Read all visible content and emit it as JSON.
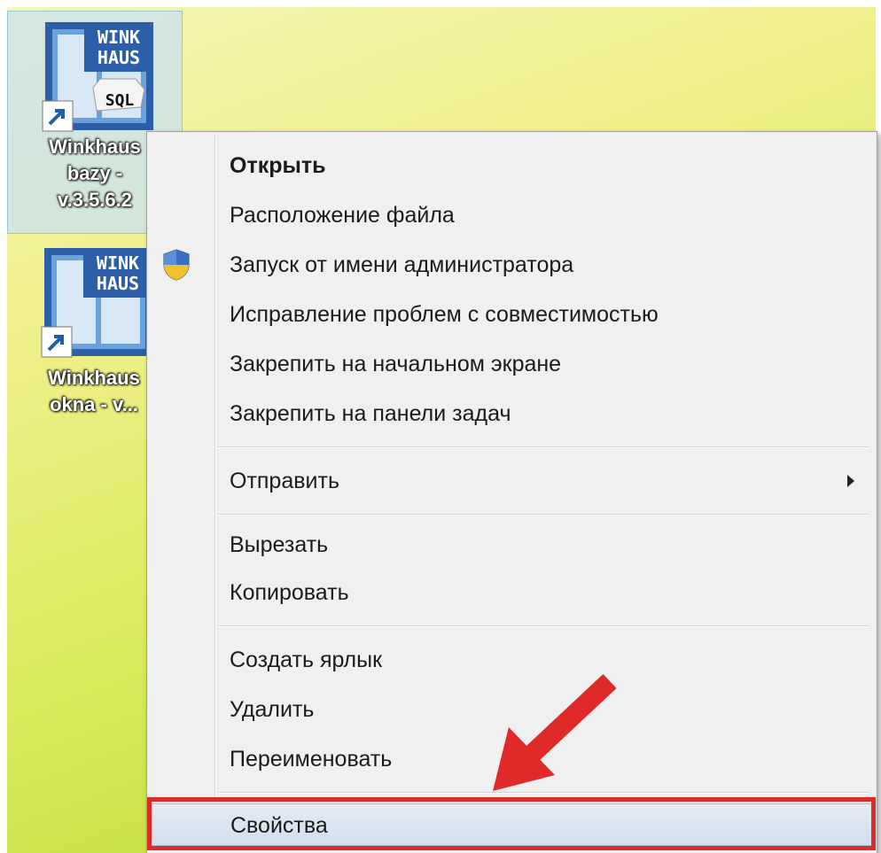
{
  "desktop": {
    "icons": [
      {
        "name": "Winkhaus bazy",
        "label_lines": [
          "Winkhaus",
          "bazy -",
          "v.3.5.6.2"
        ],
        "logo_text": [
          "WINK",
          "HAUS"
        ],
        "badge_text": "SQL",
        "selected": true
      },
      {
        "name": "Winkhaus okna",
        "label_lines": [
          "Winkhaus",
          "okna - v..."
        ],
        "logo_text": [
          "WINK",
          "HAUS"
        ],
        "selected": false
      }
    ]
  },
  "context_menu": {
    "items": [
      {
        "label": "Открыть",
        "bold": true
      },
      {
        "label": "Расположение файла"
      },
      {
        "label": "Запуск от имени администратора",
        "icon": "uac-shield-icon"
      },
      {
        "label": "Исправление проблем с совместимостью"
      },
      {
        "label": "Закрепить на начальном экране"
      },
      {
        "label": "Закрепить на панели задач"
      },
      {
        "label": "Отправить",
        "has_submenu": true
      },
      {
        "label": "Вырезать"
      },
      {
        "label": "Копировать"
      },
      {
        "label": "Создать ярлык"
      },
      {
        "label": "Удалить"
      },
      {
        "label": "Переименовать"
      },
      {
        "label": "Свойства",
        "highlighted": true
      }
    ]
  },
  "annotation": {
    "highlight_color": "#e02a2a",
    "arrow_color": "#e02a2a"
  }
}
